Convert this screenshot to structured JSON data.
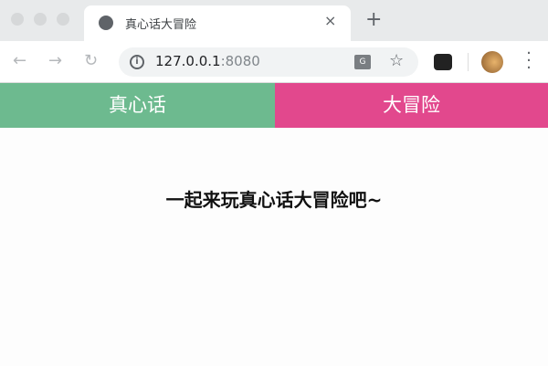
{
  "browser": {
    "tab_title": "真心话大冒险",
    "close": "×",
    "new_tab": "+",
    "url_host": "127.0.0.1",
    "url_port": ":8080",
    "translate_glyph": "G"
  },
  "page": {
    "truth_button": "真心话",
    "dare_button": "大冒险",
    "heading": "一起来玩真心话大冒险吧~"
  },
  "colors": {
    "truth": "#6dba8f",
    "dare": "#e2488d"
  }
}
